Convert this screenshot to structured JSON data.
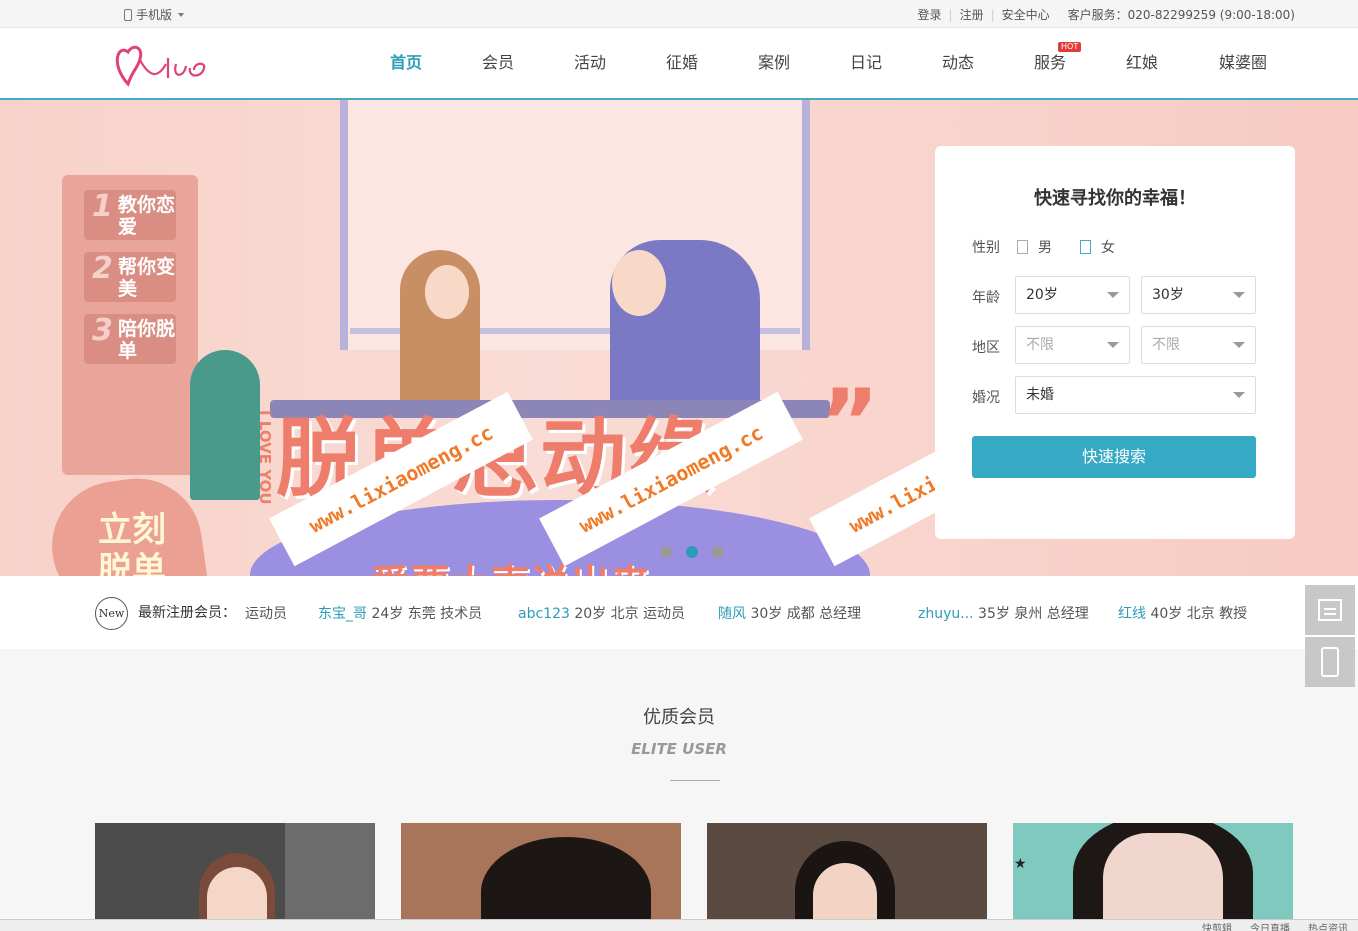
{
  "topbar": {
    "mobile_label": "手机版",
    "login": "登录",
    "register": "注册",
    "security": "安全中心",
    "service": "客户服务：020-82299259 (9:00-18:00)"
  },
  "nav": {
    "items": [
      "首页",
      "会员",
      "活动",
      "征婚",
      "案例",
      "日记",
      "动态",
      "服务",
      "红娘",
      "媒婆圈"
    ],
    "hot_badge": "HOT"
  },
  "banner": {
    "steps": [
      {
        "num": "1",
        "text": "教你恋爱"
      },
      {
        "num": "2",
        "text": "帮你变美"
      },
      {
        "num": "3",
        "text": "陪你脱单"
      }
    ],
    "heart_text": "立刻脱单",
    "slogan": "脱单总动缘",
    "slogan_quote": "”",
    "sub_slogan": "一爱要大声说出来一",
    "vertical_text": "I LOVE YOU",
    "watermark": "www.lixiaomeng.cc"
  },
  "search": {
    "title": "快速寻找你的幸福！",
    "gender_label": "性别",
    "gender_male": "男",
    "gender_female": "女",
    "age_label": "年龄",
    "age_from": "20岁",
    "age_to": "30岁",
    "region_label": "地区",
    "region_1": "不限",
    "region_2": "不限",
    "marital_label": "婚况",
    "marital_value": "未婚",
    "button": "快速搜索"
  },
  "newmembers": {
    "badge": "New",
    "label": "最新注册会员：",
    "items": [
      {
        "name": "",
        "info": "运动员"
      },
      {
        "name": "东宝_哥",
        "info": " 24岁 东莞 技术员"
      },
      {
        "name": "abc123",
        "info": " 20岁 北京 运动员"
      },
      {
        "name": "随风",
        "info": " 30岁 成都 总经理"
      },
      {
        "name": "zhuyu...",
        "info": " 35岁 泉州 总经理"
      },
      {
        "name": "红线",
        "info": " 40岁 北京 教授"
      }
    ]
  },
  "elite": {
    "title": "优质会员",
    "subtitle": "ELITE USER"
  },
  "bottombar": {
    "items": [
      "快剪辑",
      "今日直播",
      "热点资讯"
    ]
  }
}
